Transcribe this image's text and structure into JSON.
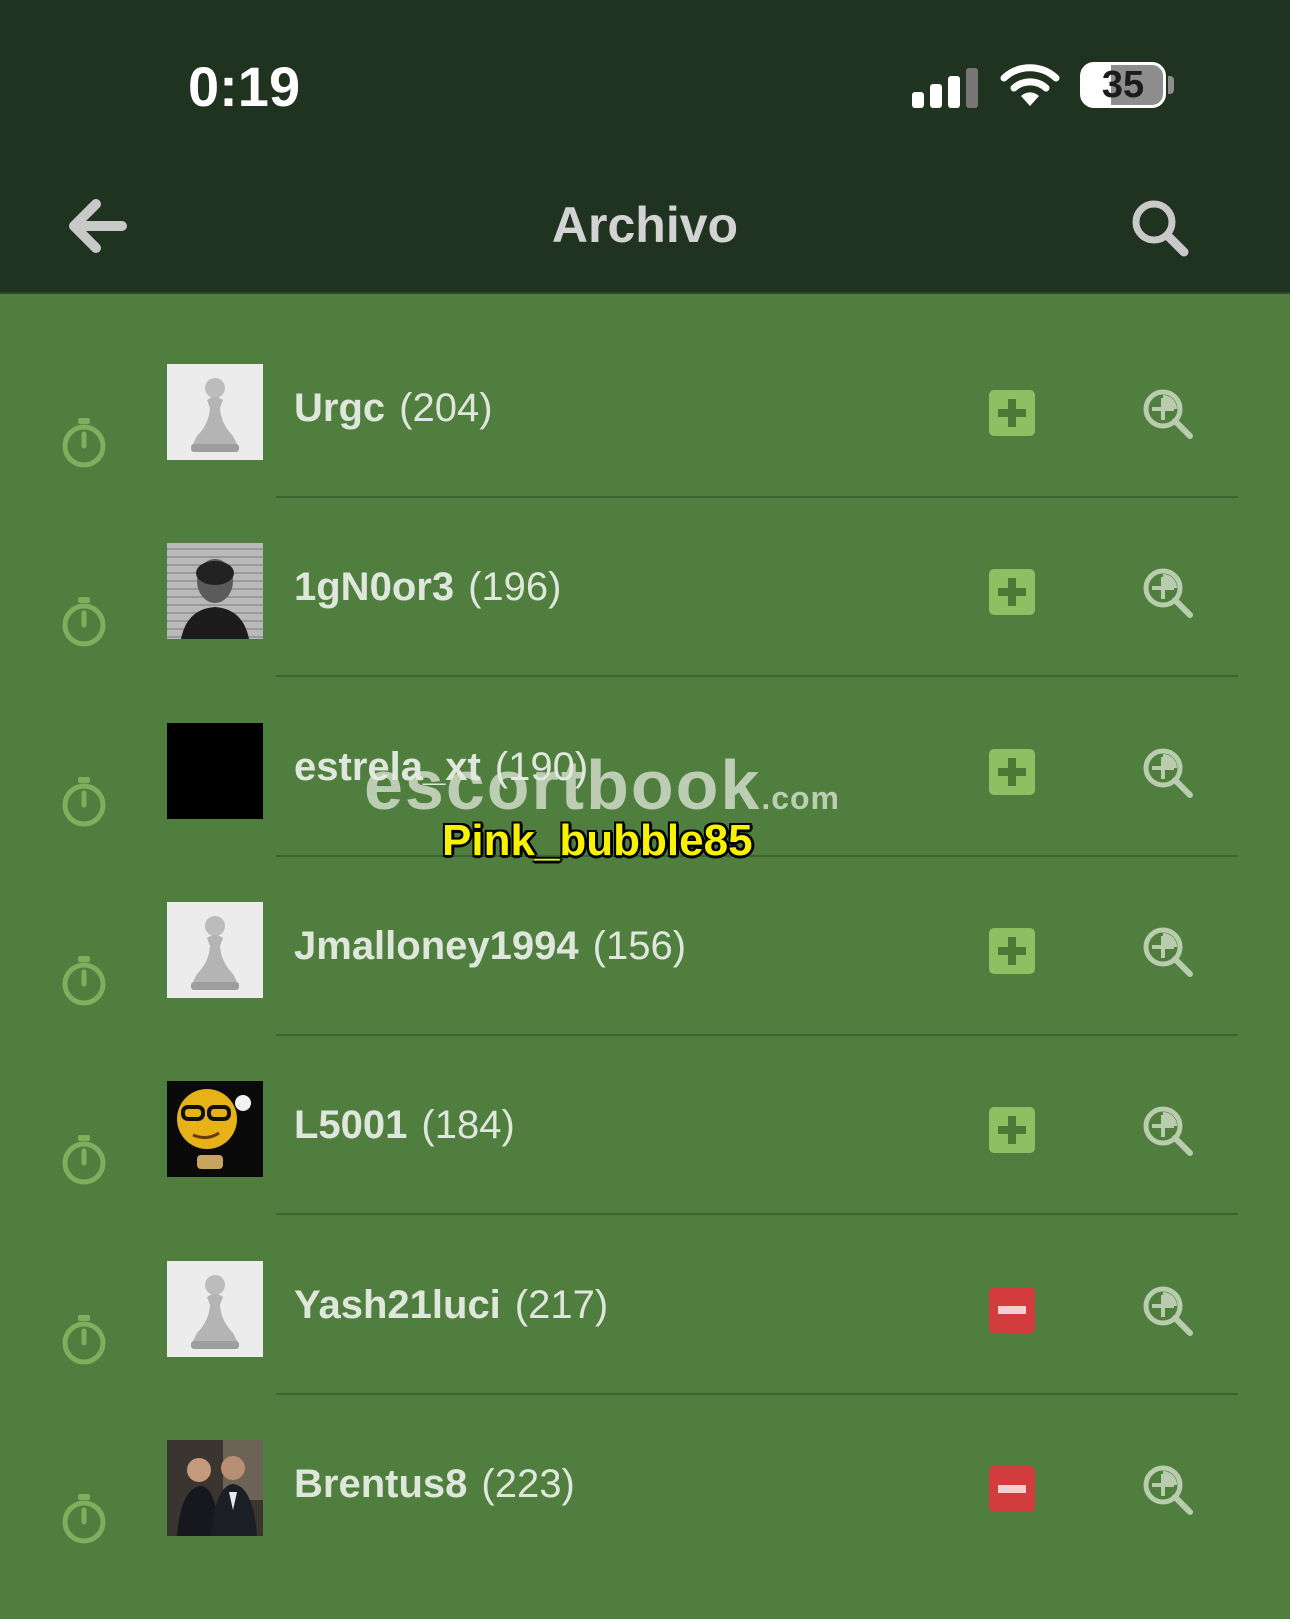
{
  "status_bar": {
    "time": "0:19",
    "battery": "35"
  },
  "nav": {
    "title": "Archivo",
    "back_icon": "back-arrow-icon",
    "search_icon": "search-icon"
  },
  "colors": {
    "add": "#8fbf63",
    "remove": "#d23c3c",
    "icon": "#b9ccae",
    "timer": "#7fae5c"
  },
  "players": [
    {
      "name": "Urgc",
      "rating": "(204)",
      "avatar": "pawn",
      "action": "add"
    },
    {
      "name": "1gN0or3",
      "rating": "(196)",
      "avatar": "photo-mugshot",
      "action": "add"
    },
    {
      "name": "estrela_xt",
      "rating": "(190)",
      "avatar": "black",
      "action": "add"
    },
    {
      "name": "Jmalloney1994",
      "rating": "(156)",
      "avatar": "pawn",
      "action": "add"
    },
    {
      "name": "L5001",
      "rating": "(184)",
      "avatar": "smiley",
      "action": "add"
    },
    {
      "name": "Yash21luci",
      "rating": "(217)",
      "avatar": "pawn",
      "action": "remove"
    },
    {
      "name": "Brentus8",
      "rating": "(223)",
      "avatar": "photo-two-men",
      "action": "remove"
    }
  ],
  "overlay": {
    "watermark": "escortbook",
    "watermark_suffix": ".com",
    "tag": "Pink_bubble85"
  }
}
